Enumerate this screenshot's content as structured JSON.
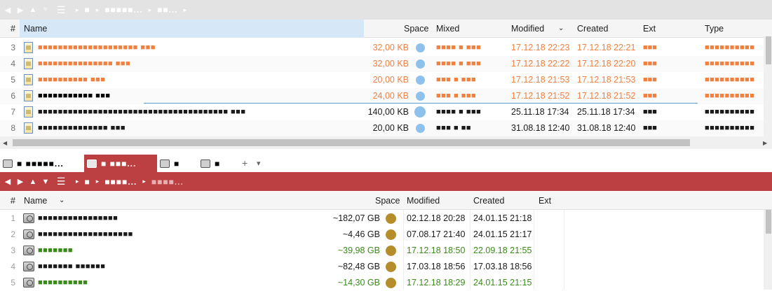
{
  "colors": {
    "accent_red": "#bc3f41",
    "highlight_orange": "#f08040",
    "green": "#3a8a1a",
    "dot_blue": "#8ec2ec",
    "dot_gold": "#b58e2b",
    "header_selected": "#d6e8f8"
  },
  "top_pane": {
    "toolbar": {
      "icons": [
        "arrow-left-icon",
        "arrow-right-icon",
        "arrow-up-icon",
        "arrow-down-icon",
        "menu-icon"
      ],
      "breadcrumbs": [
        "■",
        "■■■■■...",
        "■■..."
      ]
    },
    "columns": {
      "num": "#",
      "name": "Name",
      "space": "Space",
      "mixed": "Mixed",
      "modified": "Modified",
      "created": "Created",
      "ext": "Ext",
      "type": "Type"
    },
    "rows": [
      {
        "num": "3",
        "name": "■■■■■■■■■■■■■■■■■■■■ ■■■",
        "space": "32,00 KB",
        "mixed": "■■■■ ■ ■■■",
        "modified": "17.12.18 22:23",
        "created": "17.12.18 22:21",
        "ext": "■■■",
        "type": "■■■■■■■■■■",
        "style": "orange"
      },
      {
        "num": "4",
        "name": "■■■■■■■■■■■■■■■ ■■■",
        "space": "32,00 KB",
        "mixed": "■■■■ ■ ■■■",
        "modified": "17.12.18 22:22",
        "created": "17.12.18 22:20",
        "ext": "■■■",
        "type": "■■■■■■■■■■",
        "style": "orange"
      },
      {
        "num": "5",
        "name": "■■■■■■■■■■ ■■■",
        "space": "20,00 KB",
        "mixed": "■■■ ■ ■■■",
        "modified": "17.12.18 21:53",
        "created": "17.12.18 21:53",
        "ext": "■■■",
        "type": "■■■■■■■■■■",
        "style": "orange"
      },
      {
        "num": "6",
        "name": "■■■■■■■■■■■ ■■■",
        "space": "24,00 KB",
        "mixed": "■■■ ■ ■■■",
        "modified": "17.12.18 21:52",
        "created": "17.12.18 21:52",
        "ext": "■■■",
        "type": "■■■■■■■■■■",
        "style": "orange-edit"
      },
      {
        "num": "7",
        "name": "■■■■■■■■■■■■■■■■■■■■■■■■■■■■■■■■■■■■■■ ■■■",
        "space": "140,00 KB",
        "mixed": "■■■■ ■ ■■■",
        "modified": "25.11.18 17:34",
        "created": "25.11.18 17:34",
        "ext": "■■■",
        "type": "■■■■■■■■■■",
        "style": "normal"
      },
      {
        "num": "8",
        "name": "■■■■■■■■■■■■■■ ■■■",
        "space": "20,00 KB",
        "mixed": "■■■ ■ ■■",
        "modified": "31.08.18 12:40",
        "created": "31.08.18 12:40",
        "ext": "■■■",
        "type": "■■■■■■■■■■",
        "style": "normal"
      }
    ]
  },
  "tabs": [
    {
      "label": "■ ■■■■■...",
      "icon": "drive-icon",
      "active": false
    },
    {
      "label": "■ ■■■...",
      "icon": "drive-icon",
      "active": true
    },
    {
      "label": "■",
      "icon": "window-icon",
      "active": false
    },
    {
      "label": "■",
      "icon": "network-drive-icon",
      "active": false
    }
  ],
  "tab_actions": {
    "add": "+",
    "menu": "▾"
  },
  "bottom_pane": {
    "toolbar": {
      "icons": [
        "arrow-left-icon",
        "arrow-right-icon",
        "arrow-up-icon",
        "arrow-down-icon",
        "menu-icon"
      ],
      "breadcrumbs": [
        "■",
        "■■■■...",
        "■■■■..."
      ]
    },
    "columns": {
      "num": "#",
      "name": "Name",
      "space": "Space",
      "modified": "Modified",
      "created": "Created",
      "ext": "Ext"
    },
    "rows": [
      {
        "num": "1",
        "name": "■■■■■■■■■■■■■■■■",
        "space": "~182,07 GB",
        "modified": "02.12.18 20:28",
        "created": "24.01.15 21:18",
        "style": "normal"
      },
      {
        "num": "2",
        "name": "■■■■■■■■■■■■■■■■■■■",
        "space": "~4,46 GB",
        "modified": "07.08.17 21:40",
        "created": "24.01.15 21:17",
        "style": "normal"
      },
      {
        "num": "3",
        "name": "■■■■■■■",
        "space": "~39,98 GB",
        "modified": "17.12.18 18:50",
        "created": "22.09.18 21:55",
        "style": "green"
      },
      {
        "num": "4",
        "name": "■■■■■■■ ■■■■■■",
        "space": "~82,48 GB",
        "modified": "17.03.18 18:56",
        "created": "17.03.18 18:56",
        "style": "normal"
      },
      {
        "num": "5",
        "name": "■■■■■■■■■■",
        "space": "~14,30 GB",
        "modified": "17.12.18 18:29",
        "created": "24.01.15 21:15",
        "style": "green"
      }
    ]
  }
}
